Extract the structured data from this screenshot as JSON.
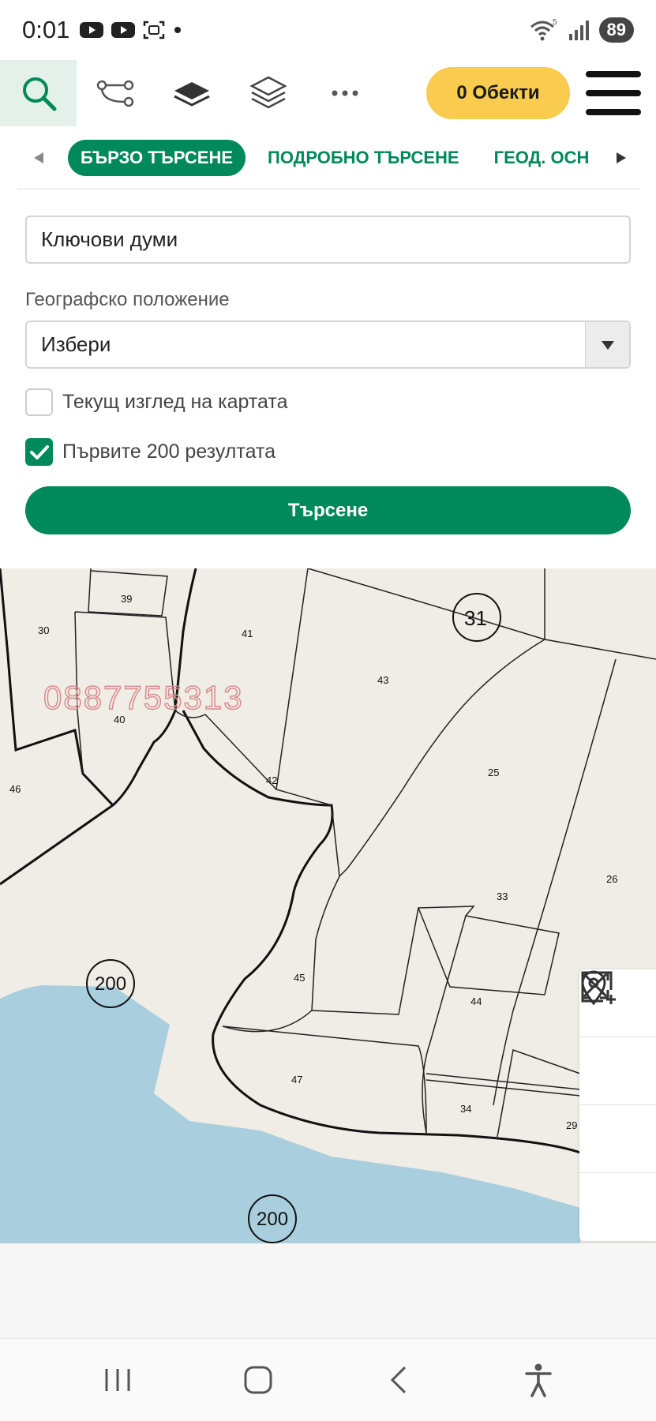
{
  "status_bar": {
    "time": "0:01",
    "battery": "89",
    "wifi_badge": "5"
  },
  "toolbar": {
    "objects_label": "0 Обекти",
    "icons": [
      "search-icon",
      "route-icon",
      "layer-icon",
      "layers-icon",
      "more-icon",
      "menu-icon"
    ]
  },
  "tabs": [
    {
      "label": "БЪРЗО ТЪРСЕНЕ",
      "active": true
    },
    {
      "label": "ПОДРОБНО ТЪРСЕНЕ",
      "active": false
    },
    {
      "label": "ГЕОД. ОСН",
      "active": false
    }
  ],
  "form": {
    "keywords_placeholder": "Ключови думи",
    "geo_label": "Географско положение",
    "geo_selected": "Избери",
    "current_view_label": "Текущ изглед на картата",
    "current_view_checked": false,
    "first200_label": "Първите 200 резултата",
    "first200_checked": true,
    "search_label": "Търсене"
  },
  "map": {
    "watermark": "0887755313",
    "parcels": [
      "39",
      "30",
      "41",
      "43",
      "31",
      "40",
      "46",
      "42",
      "25",
      "33",
      "26",
      "45",
      "44",
      "47",
      "34",
      "29",
      "200",
      "200"
    ],
    "controls": [
      "location-pin-icon",
      "zoom-box-in-icon",
      "zoom-box-out-icon",
      "fullscreen-icon"
    ],
    "water_color": "#a9cfde",
    "land_color": "#f0ede6"
  },
  "colors": {
    "accent": "#00895a",
    "objects_button": "#f9cc4f"
  }
}
